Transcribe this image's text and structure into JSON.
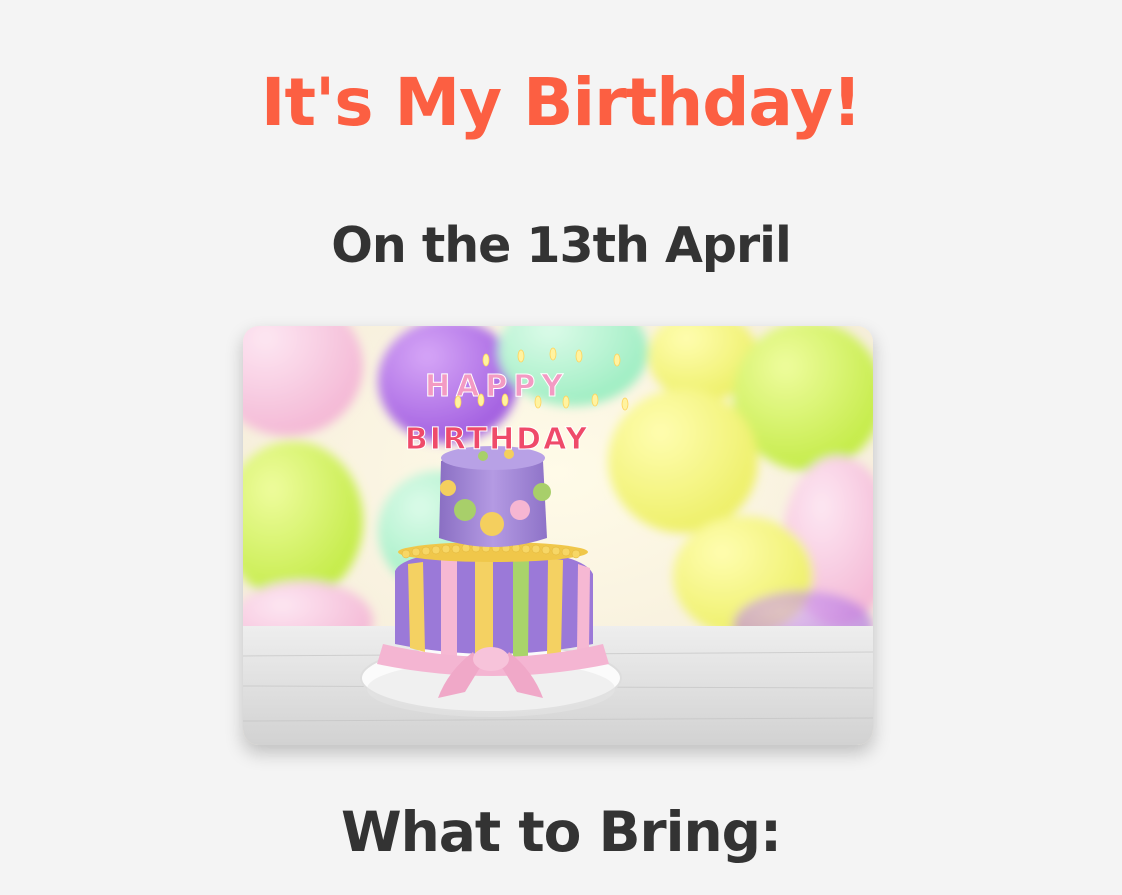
{
  "header": {
    "title": "It's My Birthday!",
    "date_line": "On the 13th April"
  },
  "photo": {
    "cake_lettering_top": "HAPPY",
    "cake_lettering_bottom": "BIRTHDAY"
  },
  "section": {
    "heading": "What to Bring:"
  },
  "colors": {
    "accent": "#fc5f42",
    "heading": "#333333",
    "background": "#f4f4f4"
  }
}
